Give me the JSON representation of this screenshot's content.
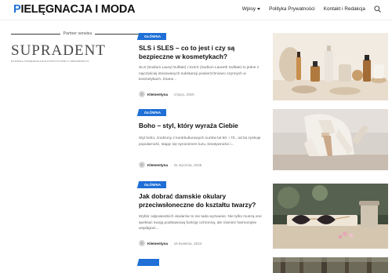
{
  "site": {
    "logo_first": "P",
    "logo_rest": "IELĘGNACJA I MODA"
  },
  "nav": {
    "items": [
      {
        "label": "Wpisy",
        "has_dropdown": true
      },
      {
        "label": "Polityka Prywatności"
      },
      {
        "label": "Kontakt i Redakcja"
      }
    ],
    "search_icon": "search-icon"
  },
  "sidebar": {
    "partner_title": "Partner serwisu",
    "partner_logo_lettering": "SUPRADENT",
    "partner_logo_subtitle": "KLINIKA STOMATOLOGII ESTETYCZNEJ I ORTODONCJI"
  },
  "colors": {
    "accent": "#1f6fd6"
  },
  "articles": [
    {
      "category": "GŁÓWNA",
      "title": "SLS i SLES – co to jest i czy są bezpieczne w kosmetykach?",
      "excerpt": "SLS (Sodium Lauryl Sulfate) i SLES (Sodium Laureth Sulfate) to jedne z najczęściej stosowanych substancji powierzchniowo czynnych w kosmetykach. Znane...",
      "author": "Klementyna",
      "date": "4 lipca, 2025"
    },
    {
      "category": "GŁÓWNA",
      "title": "Boho – styl, który wyraża Ciebie",
      "excerpt": "Styl boho, zrodzony z kontrkulturowych nurtów lat 60. i 70., od lat zyskuje popularność, stając się synonimem luzu, kreatywności i...",
      "author": "Klementyna",
      "date": "31 stycznia, 2025"
    },
    {
      "category": "GŁÓWNA",
      "title": "Jak dobrać damskie okulary przeciwsłoneczne do kształtu twarzy?",
      "excerpt": "Wybór odpowiednich okularów to nie tada wyzwanie. Nie tylko muszą one spełniać swoją podstawową funkcję ochronną, ale również harmonijnie współgrać...",
      "author": "Klementyna",
      "date": "16 kwietnia, 2024"
    }
  ]
}
